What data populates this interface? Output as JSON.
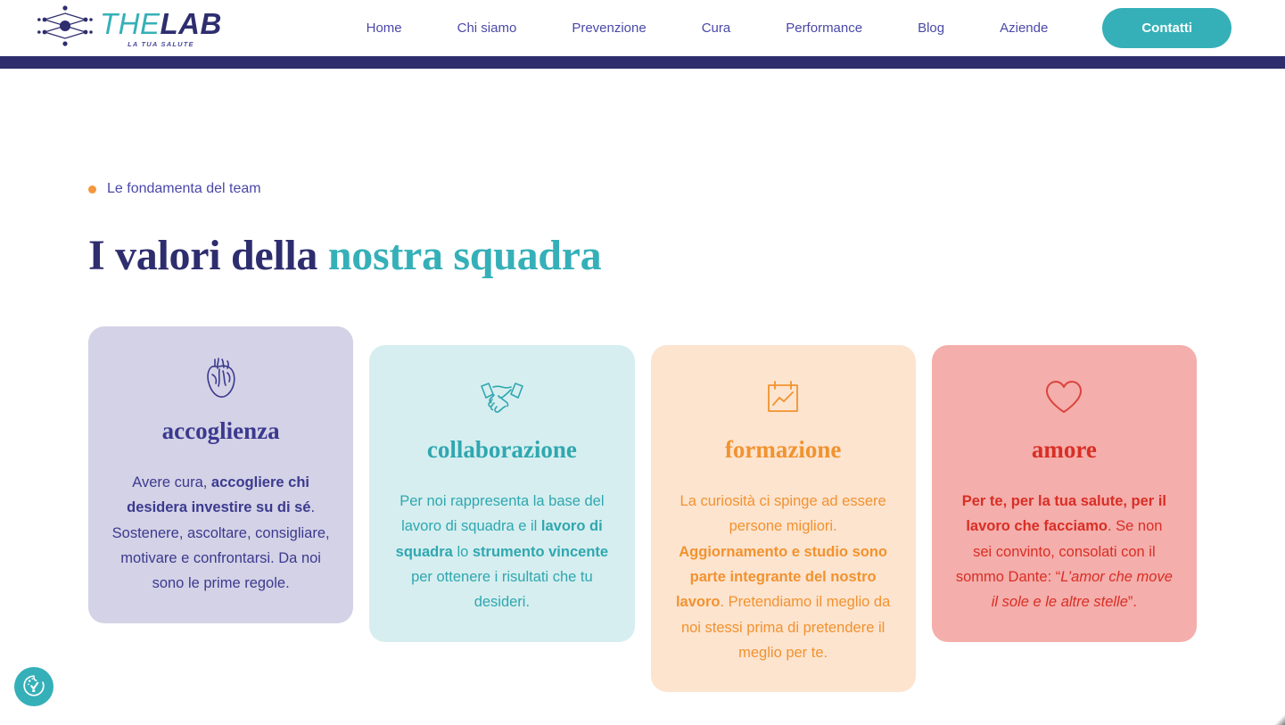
{
  "header": {
    "logo": {
      "icon": "network-nodes-icon",
      "word_the": "THE",
      "word_lab": "LAB",
      "tagline": "LA TUA SALUTE"
    },
    "nav_items": [
      {
        "label": "Home"
      },
      {
        "label": "Chi siamo"
      },
      {
        "label": "Prevenzione"
      },
      {
        "label": "Cura"
      },
      {
        "label": "Performance"
      },
      {
        "label": "Blog"
      },
      {
        "label": "Aziende"
      }
    ],
    "cta_label": "Contatti",
    "bar_color": "#2e2d6e"
  },
  "section": {
    "eyebrow": "Le fondamenta del team",
    "eyebrow_dot_color": "#f5963c",
    "title_part_1": "I valori della ",
    "title_part_2": "nostra squadra",
    "title_color": "#2e2d6e",
    "title_accent_color": "#35b0b8"
  },
  "cards": [
    {
      "key": "accoglienza",
      "icon": "anatomical-heart-icon",
      "title": "accoglienza",
      "bg": "#d4d2e6",
      "fg": "#3b3a8f",
      "body": [
        {
          "text": "Avere cura, ",
          "bold": false
        },
        {
          "text": "accogliere chi desidera investire su di sé",
          "bold": true
        },
        {
          "text": ". Sostenere, ascoltare, consigliare, motivare e confrontarsi. Da noi sono le prime regole.",
          "bold": false
        }
      ]
    },
    {
      "key": "collaborazione",
      "icon": "handshake-icon",
      "title": "collaborazione",
      "bg": "#d6eeef",
      "fg": "#2fa7b0",
      "body": [
        {
          "text": "Per noi rappresenta la base del lavoro di squadra e il ",
          "bold": false
        },
        {
          "text": "lavoro di squadra",
          "bold": true
        },
        {
          "text": " lo ",
          "bold": false
        },
        {
          "text": "strumento vincente",
          "bold": true
        },
        {
          "text": " per ottenere i risultati che tu desideri.",
          "bold": false
        }
      ]
    },
    {
      "key": "formazione",
      "icon": "chart-clipboard-icon",
      "title": "formazione",
      "bg": "#fce4cf",
      "fg": "#f2922f",
      "body": [
        {
          "text": "La curiosità ci spinge ad essere persone migliori. ",
          "bold": false
        },
        {
          "text": "Aggiornamento e studio sono parte integrante del nostro lavoro",
          "bold": true
        },
        {
          "text": ". Pretendiamo il meglio da noi stessi prima di pretendere il meglio per te.",
          "bold": false
        }
      ]
    },
    {
      "key": "amore",
      "icon": "heart-outline-icon",
      "title": "amore",
      "bg": "#f4aeab",
      "fg": "#d92e25",
      "body": [
        {
          "text": "Per te, per la tua salute, per il lavoro che facciamo",
          "bold": true
        },
        {
          "text": ". Se non sei convinto, consolati con il sommo Dante: “",
          "bold": false
        },
        {
          "text": "L’amor che move il sole e le altre stelle",
          "bold": false,
          "italic": true
        },
        {
          "text": "”.",
          "bold": false
        }
      ]
    }
  ],
  "accessibility_widget": {
    "icon": "accessibility-cookie-check-icon",
    "color": "#35b0b8"
  }
}
